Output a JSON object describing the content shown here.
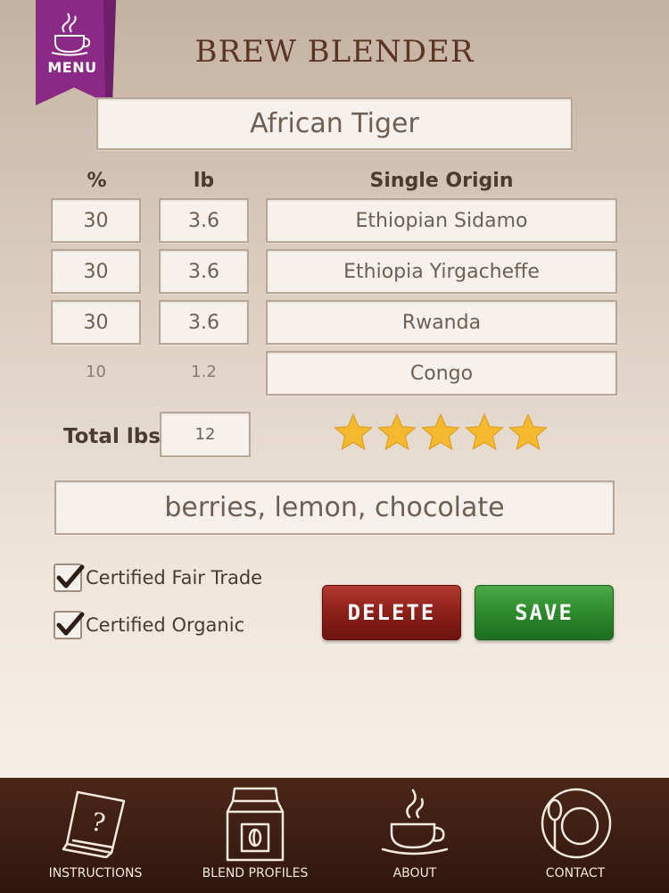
{
  "menu": {
    "label": "MENU"
  },
  "app": {
    "title": "BREW BLENDER"
  },
  "blend": {
    "name": "African Tiger"
  },
  "table": {
    "headers": {
      "percent": "%",
      "lb": "lb",
      "origin": "Single Origin"
    },
    "rows": [
      {
        "percent": "30",
        "lb": "3.6",
        "origin": "Ethiopian Sidamo"
      },
      {
        "percent": "30",
        "lb": "3.6",
        "origin": "Ethiopia Yirgacheffe"
      },
      {
        "percent": "30",
        "lb": "3.6",
        "origin": "Rwanda"
      },
      {
        "percent": "10",
        "lb": "1.2",
        "origin": "Congo"
      }
    ]
  },
  "total": {
    "label": "Total lbs",
    "value": "12"
  },
  "rating": {
    "stars": 5,
    "max": 5,
    "color": "#f5b82e"
  },
  "notes": {
    "value": "berries, lemon, chocolate"
  },
  "certifications": [
    {
      "label": "Certified Fair Trade",
      "checked": true
    },
    {
      "label": "Certified Organic",
      "checked": true
    }
  ],
  "actions": {
    "delete_label": "DELETE",
    "save_label": "SAVE"
  },
  "nav": [
    {
      "label": "INSTRUCTIONS",
      "icon": "book-question-icon"
    },
    {
      "label": "BLEND PROFILES",
      "icon": "coffee-bag-icon"
    },
    {
      "label": "ABOUT",
      "icon": "coffee-cup-icon"
    },
    {
      "label": "CONTACT",
      "icon": "plate-spoon-icon"
    }
  ],
  "colors": {
    "ribbon": "#8a2a86",
    "title": "#5a3524",
    "delete": "#8c1f19",
    "save": "#2d8a2c",
    "bar": "#3b1d12"
  }
}
